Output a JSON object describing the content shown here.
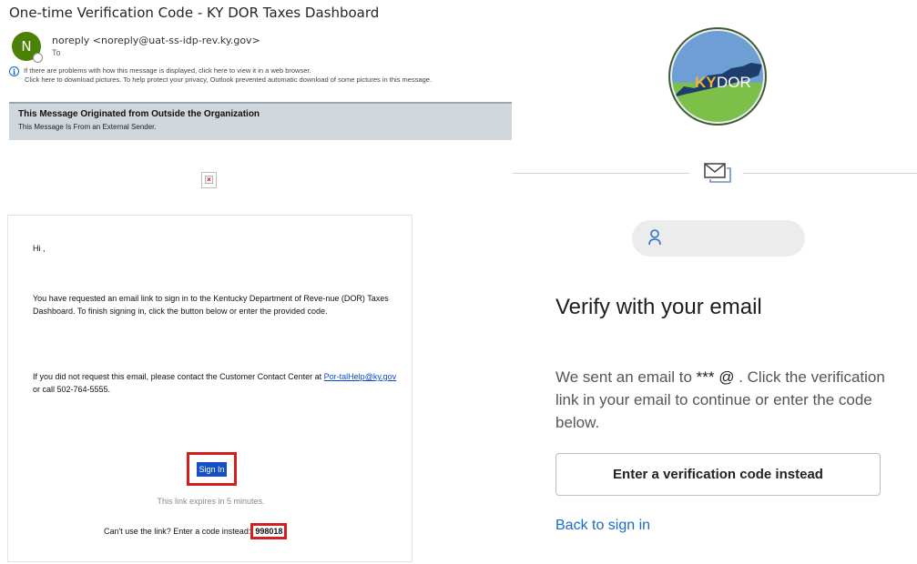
{
  "email": {
    "subject": "One-time Verification Code - KY DOR Taxes Dashboard",
    "avatar_initial": "N",
    "sender": "noreply <noreply@uat-ss-idp-rev.ky.gov>",
    "to_label": "To",
    "info_line1": "If there are problems with how this message is displayed, click here to view it in a web browser.",
    "info_line2": "Click here to download pictures. To help protect your privacy, Outlook prevented automatic download of some pictures in this message.",
    "banner_title": "This Message Originated from Outside the Organization",
    "banner_subtitle": "This Message Is From an External Sender.",
    "broken_image_glyph": "×",
    "body": {
      "greeting": "Hi     ,",
      "paragraph1": "You have requested an email link to sign in to the Kentucky Department of Reve-nue (DOR) Taxes Dashboard. To finish signing in, click the button below or enter the provided code.",
      "paragraph2_text": "If you did not request this email, please contact the Customer Contact Center at ",
      "paragraph2_link": "Por-talHelp@ky.gov",
      "paragraph2_tail": " or call 502-764-5555.",
      "signin_label": "Sign In",
      "expires": "This link expires in 5 minutes.",
      "code_prompt": "Can't use the link? Enter a code instead:",
      "code": "998018"
    }
  },
  "verify": {
    "logo_text_ky": "KY",
    "logo_text_dor": "DOR",
    "username": "",
    "title": "Verify with your email",
    "desc_before": "We sent an email to ",
    "masked_email": "*** @",
    "desc_after": "        . Click the verification link in your email to continue or enter the code below.",
    "code_button": "Enter a verification code instead",
    "back_link": "Back to sign in"
  },
  "colors": {
    "avatar": "#498205",
    "highlight_border": "#d41f1f",
    "signin_button": "#1550c7",
    "link_blue": "#1a6ac9",
    "banner": "#cfd6dc"
  },
  "icons": [
    "info-icon",
    "broken-image-icon",
    "envelope-icon",
    "user-icon",
    "kydor-logo"
  ]
}
